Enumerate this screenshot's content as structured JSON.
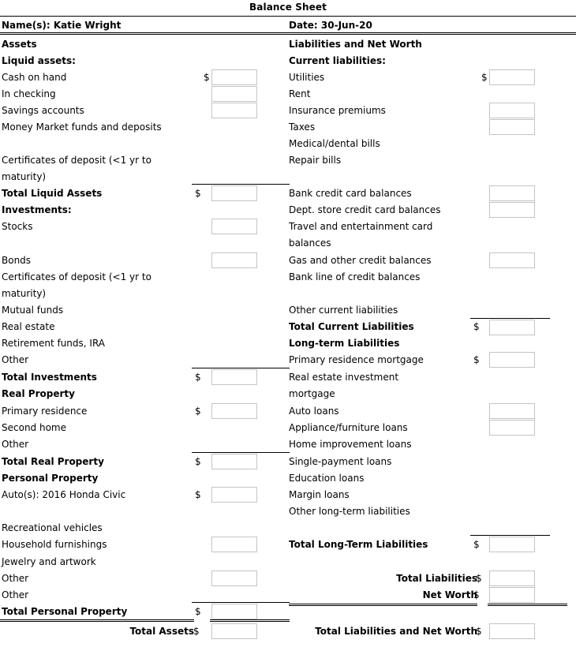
{
  "document": {
    "title": "Balance Sheet",
    "name_label": "Name(s): Katie Wright",
    "date_label": "Date: 30-Jun-20"
  },
  "columns": {
    "assets_heading": "Assets",
    "liabilities_heading": "Liabilities and Net Worth"
  },
  "assets": {
    "liquid_heading": "Liquid assets:",
    "liquid_items": [
      "Cash on hand",
      "In checking",
      "Savings accounts",
      "Money Market funds and deposits",
      "Certificates of deposit (<1 yr to",
      "maturity)"
    ],
    "total_liquid": "Total Liquid Assets",
    "investments_heading": "Investments:",
    "investment_items": [
      "Stocks",
      "Bonds",
      "Certificates of deposit (<1 yr to",
      "maturity)",
      "Mutual funds",
      "Real estate",
      "Retirement funds, IRA",
      "Other"
    ],
    "total_investments": "Total Investments",
    "real_property_heading": "Real Property",
    "real_property_items": [
      "Primary residence",
      "Second home",
      "Other"
    ],
    "total_real_property": "Total Real Property",
    "personal_property_heading": "Personal Property",
    "personal_property_items": [
      "Auto(s): 2016 Honda Civic",
      "Recreational vehicles",
      "Household furnishings",
      "Jewelry and artwork",
      "Other",
      "Other"
    ],
    "total_personal_property": "Total Personal Property",
    "total_assets": "Total Assets"
  },
  "liabilities": {
    "current_heading": "Current liabilities:",
    "current_items": [
      "Utilities",
      "Rent",
      "Insurance premiums",
      "Taxes",
      "Medical/dental bills",
      "Repair bills",
      "Bank credit card balances",
      "Dept. store credit card balances",
      "Travel and entertainment card",
      "balances",
      "Gas and other credit balances",
      "Bank line of credit balances",
      "Other current liabilities"
    ],
    "total_current": "Total Current Liabilities",
    "longterm_heading": "Long-term Liabilities",
    "longterm_items": [
      "Primary residence mortgage",
      "Real estate investment",
      "mortgage",
      "Auto loans",
      "Appliance/furniture loans",
      "Home improvement loans",
      "Single-payment loans",
      "Education loans",
      "Margin loans",
      "Other long-term liabilities"
    ],
    "total_longterm": "Total Long-Term Liabilities",
    "total_liabilities": "Total Liabilities",
    "net_worth": "Net Worth",
    "total_liabilities_and_net_worth": "Total Liabilities and Net Worth"
  },
  "symbols": {
    "dollar": "$"
  },
  "inputs": {
    "cash_on_hand": "",
    "in_checking": "",
    "savings_accounts": "",
    "total_liquid_assets": "",
    "stocks": "",
    "bonds": "",
    "total_investments": "",
    "primary_residence": "",
    "total_real_property": "",
    "autos": "",
    "household_furnishings": "",
    "other_personal_1": "",
    "total_personal_property": "",
    "total_assets": "",
    "utilities": "",
    "insurance_premiums": "",
    "taxes": "",
    "bank_credit_card": "",
    "dept_store_credit_card": "",
    "gas_and_other_credit": "",
    "total_current_liabilities": "",
    "primary_residence_mortgage": "",
    "auto_loans": "",
    "appliance_furniture_loans": "",
    "total_longterm_liabilities": "",
    "total_liabilities": "",
    "net_worth": "",
    "total_liabilities_and_net_worth": ""
  },
  "colors": {
    "text": "#000000",
    "rule": "#000000",
    "input_border": "#c4c4c4",
    "background": "#ffffff"
  }
}
